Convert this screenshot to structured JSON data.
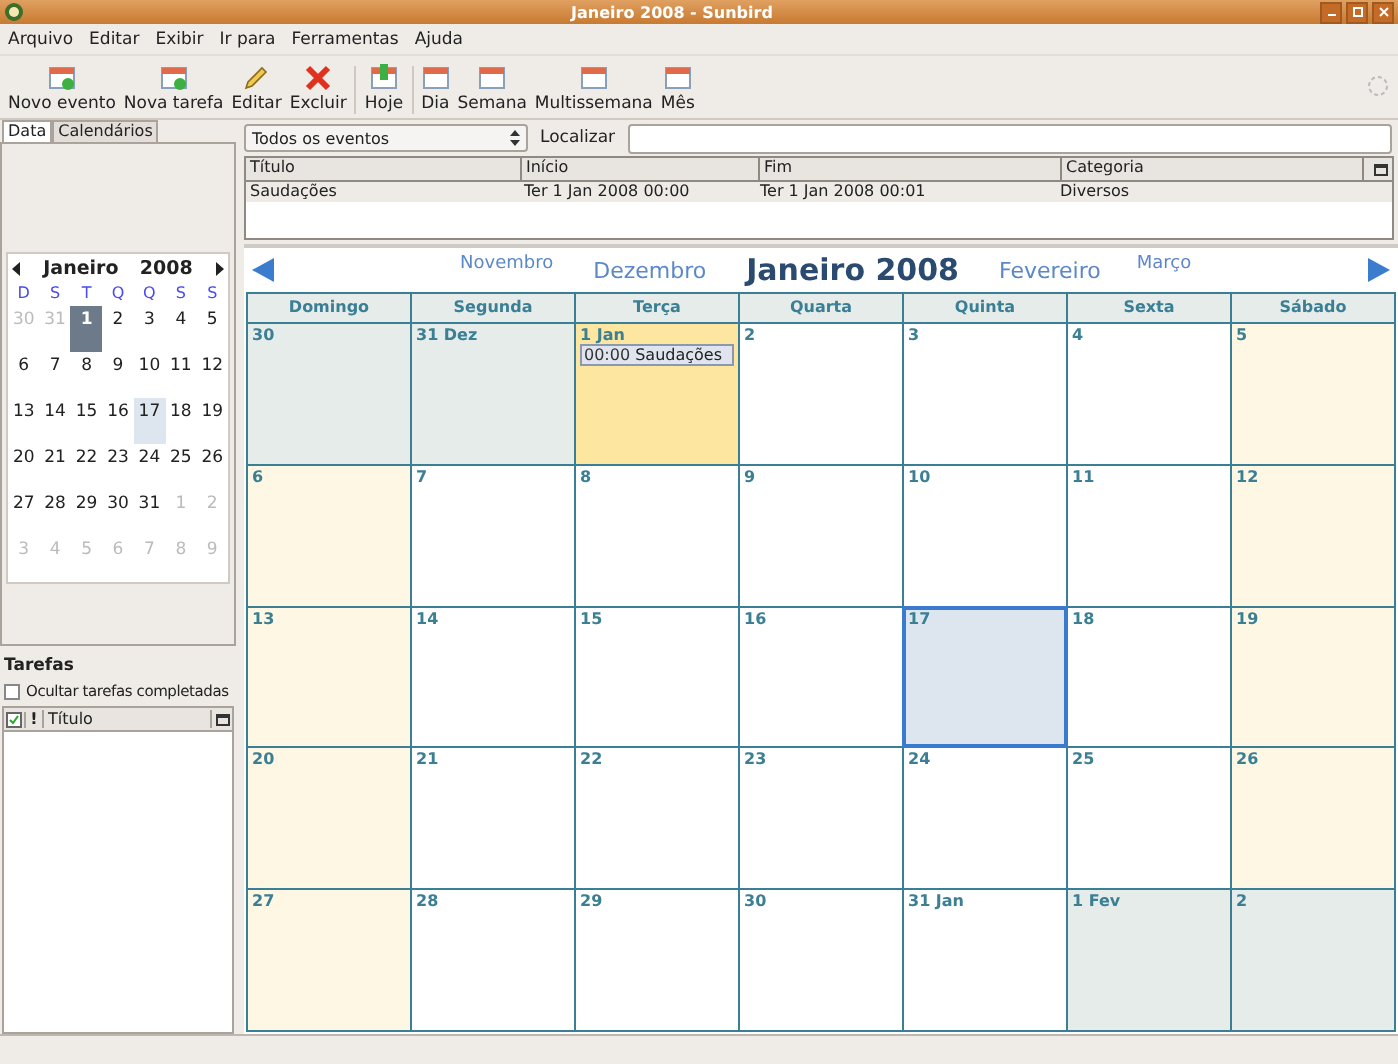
{
  "window": {
    "title": "Janeiro 2008 - Sunbird"
  },
  "menu": [
    "Arquivo",
    "Editar",
    "Exibir",
    "Ir para",
    "Ferramentas",
    "Ajuda"
  ],
  "toolbar": [
    [
      {
        "label": "Novo evento"
      },
      {
        "label": "Nova tarefa"
      },
      {
        "label": "Editar"
      },
      {
        "label": "Excluir"
      }
    ],
    [
      {
        "label": "Hoje"
      }
    ],
    [
      {
        "label": "Dia"
      },
      {
        "label": "Semana"
      },
      {
        "label": "Multissemana"
      },
      {
        "label": "Mês"
      }
    ]
  ],
  "sidebar_tabs": [
    {
      "label": "Data",
      "selected": true
    },
    {
      "label": "Calendários",
      "selected": false
    }
  ],
  "mini_calendar": {
    "month": "Janeiro",
    "year": "2008",
    "weekdays": [
      "D",
      "S",
      "T",
      "Q",
      "Q",
      "S",
      "S"
    ],
    "weeks": [
      [
        {
          "d": "30",
          "other": true,
          "selected": false,
          "today": false
        },
        {
          "d": "31",
          "other": true,
          "selected": false,
          "today": false
        },
        {
          "d": "1",
          "other": false,
          "selected": true,
          "today": false
        },
        {
          "d": "2",
          "other": false,
          "selected": false,
          "today": false
        },
        {
          "d": "3",
          "other": false,
          "selected": false,
          "today": false
        },
        {
          "d": "4",
          "other": false,
          "selected": false,
          "today": false
        },
        {
          "d": "5",
          "other": false,
          "selected": false,
          "today": false
        }
      ],
      [
        {
          "d": "6",
          "other": false,
          "selected": false,
          "today": false
        },
        {
          "d": "7",
          "other": false,
          "selected": false,
          "today": false
        },
        {
          "d": "8",
          "other": false,
          "selected": false,
          "today": false
        },
        {
          "d": "9",
          "other": false,
          "selected": false,
          "today": false
        },
        {
          "d": "10",
          "other": false,
          "selected": false,
          "today": false
        },
        {
          "d": "11",
          "other": false,
          "selected": false,
          "today": false
        },
        {
          "d": "12",
          "other": false,
          "selected": false,
          "today": false
        }
      ],
      [
        {
          "d": "13",
          "other": false,
          "selected": false,
          "today": false
        },
        {
          "d": "14",
          "other": false,
          "selected": false,
          "today": false
        },
        {
          "d": "15",
          "other": false,
          "selected": false,
          "today": false
        },
        {
          "d": "16",
          "other": false,
          "selected": false,
          "today": false
        },
        {
          "d": "17",
          "other": false,
          "selected": false,
          "today": true
        },
        {
          "d": "18",
          "other": false,
          "selected": false,
          "today": false
        },
        {
          "d": "19",
          "other": false,
          "selected": false,
          "today": false
        }
      ],
      [
        {
          "d": "20",
          "other": false,
          "selected": false,
          "today": false
        },
        {
          "d": "21",
          "other": false,
          "selected": false,
          "today": false
        },
        {
          "d": "22",
          "other": false,
          "selected": false,
          "today": false
        },
        {
          "d": "23",
          "other": false,
          "selected": false,
          "today": false
        },
        {
          "d": "24",
          "other": false,
          "selected": false,
          "today": false
        },
        {
          "d": "25",
          "other": false,
          "selected": false,
          "today": false
        },
        {
          "d": "26",
          "other": false,
          "selected": false,
          "today": false
        }
      ],
      [
        {
          "d": "27",
          "other": false,
          "selected": false,
          "today": false
        },
        {
          "d": "28",
          "other": false,
          "selected": false,
          "today": false
        },
        {
          "d": "29",
          "other": false,
          "selected": false,
          "today": false
        },
        {
          "d": "30",
          "other": false,
          "selected": false,
          "today": false
        },
        {
          "d": "31",
          "other": false,
          "selected": false,
          "today": false
        },
        {
          "d": "1",
          "other": true,
          "selected": false,
          "today": false
        },
        {
          "d": "2",
          "other": true,
          "selected": false,
          "today": false
        }
      ],
      [
        {
          "d": "3",
          "other": true,
          "selected": false,
          "today": false
        },
        {
          "d": "4",
          "other": true,
          "selected": false,
          "today": false
        },
        {
          "d": "5",
          "other": true,
          "selected": false,
          "today": false
        },
        {
          "d": "6",
          "other": true,
          "selected": false,
          "today": false
        },
        {
          "d": "7",
          "other": true,
          "selected": false,
          "today": false
        },
        {
          "d": "8",
          "other": true,
          "selected": false,
          "today": false
        },
        {
          "d": "9",
          "other": true,
          "selected": false,
          "today": false
        }
      ]
    ]
  },
  "tasks": {
    "title": "Tarefas",
    "hide_completed": {
      "label": "Ocultar tarefas completadas",
      "checked": false
    },
    "columns": [
      "!",
      "Título"
    ]
  },
  "filter": {
    "value": "Todos os eventos",
    "search_label": "Localizar"
  },
  "events_table": {
    "columns": [
      "Título",
      "Início",
      "Fim",
      "Categoria"
    ],
    "rows": [
      {
        "cells": [
          "Saudações",
          "Ter 1 Jan 2008 00:00",
          "Ter 1 Jan 2008 00:01",
          "Diversos"
        ]
      }
    ]
  },
  "month_nav": {
    "prev2": "Novembro",
    "prev1": "Dezembro",
    "current": "Janeiro 2008",
    "next1": "Fevereiro",
    "next2": "Março"
  },
  "month_view": {
    "weekdays": [
      "Domingo",
      "Segunda",
      "Terça",
      "Quarta",
      "Quinta",
      "Sexta",
      "Sábado"
    ],
    "weeks": [
      [
        {
          "label": "30",
          "kind": "other",
          "selected": false,
          "today": false
        },
        {
          "label": "31 Dez",
          "kind": "other",
          "selected": false,
          "today": false
        },
        {
          "label": "1 Jan",
          "kind": "weekday",
          "selected": true,
          "today": false,
          "events": [
            {
              "time": "00:00",
              "title": "Saudações"
            }
          ]
        },
        {
          "label": "2",
          "kind": "weekday",
          "selected": false,
          "today": false
        },
        {
          "label": "3",
          "kind": "weekday",
          "selected": false,
          "today": false
        },
        {
          "label": "4",
          "kind": "weekday",
          "selected": false,
          "today": false
        },
        {
          "label": "5",
          "kind": "weekend",
          "selected": false,
          "today": false
        }
      ],
      [
        {
          "label": "6",
          "kind": "weekend",
          "selected": false,
          "today": false
        },
        {
          "label": "7",
          "kind": "weekday",
          "selected": false,
          "today": false
        },
        {
          "label": "8",
          "kind": "weekday",
          "selected": false,
          "today": false
        },
        {
          "label": "9",
          "kind": "weekday",
          "selected": false,
          "today": false
        },
        {
          "label": "10",
          "kind": "weekday",
          "selected": false,
          "today": false
        },
        {
          "label": "11",
          "kind": "weekday",
          "selected": false,
          "today": false
        },
        {
          "label": "12",
          "kind": "weekend",
          "selected": false,
          "today": false
        }
      ],
      [
        {
          "label": "13",
          "kind": "weekend",
          "selected": false,
          "today": false
        },
        {
          "label": "14",
          "kind": "weekday",
          "selected": false,
          "today": false
        },
        {
          "label": "15",
          "kind": "weekday",
          "selected": false,
          "today": false
        },
        {
          "label": "16",
          "kind": "weekday",
          "selected": false,
          "today": false
        },
        {
          "label": "17",
          "kind": "weekday",
          "selected": false,
          "today": true
        },
        {
          "label": "18",
          "kind": "weekday",
          "selected": false,
          "today": false
        },
        {
          "label": "19",
          "kind": "weekend",
          "selected": false,
          "today": false
        }
      ],
      [
        {
          "label": "20",
          "kind": "weekend",
          "selected": false,
          "today": false
        },
        {
          "label": "21",
          "kind": "weekday",
          "selected": false,
          "today": false
        },
        {
          "label": "22",
          "kind": "weekday",
          "selected": false,
          "today": false
        },
        {
          "label": "23",
          "kind": "weekday",
          "selected": false,
          "today": false
        },
        {
          "label": "24",
          "kind": "weekday",
          "selected": false,
          "today": false
        },
        {
          "label": "25",
          "kind": "weekday",
          "selected": false,
          "today": false
        },
        {
          "label": "26",
          "kind": "weekend",
          "selected": false,
          "today": false
        }
      ],
      [
        {
          "label": "27",
          "kind": "weekend",
          "selected": false,
          "today": false
        },
        {
          "label": "28",
          "kind": "weekday",
          "selected": false,
          "today": false
        },
        {
          "label": "29",
          "kind": "weekday",
          "selected": false,
          "today": false
        },
        {
          "label": "30",
          "kind": "weekday",
          "selected": false,
          "today": false
        },
        {
          "label": "31 Jan",
          "kind": "weekday",
          "selected": false,
          "today": false
        },
        {
          "label": "1 Fev",
          "kind": "other",
          "selected": false,
          "today": false
        },
        {
          "label": "2",
          "kind": "other",
          "selected": false,
          "today": false
        }
      ]
    ]
  }
}
